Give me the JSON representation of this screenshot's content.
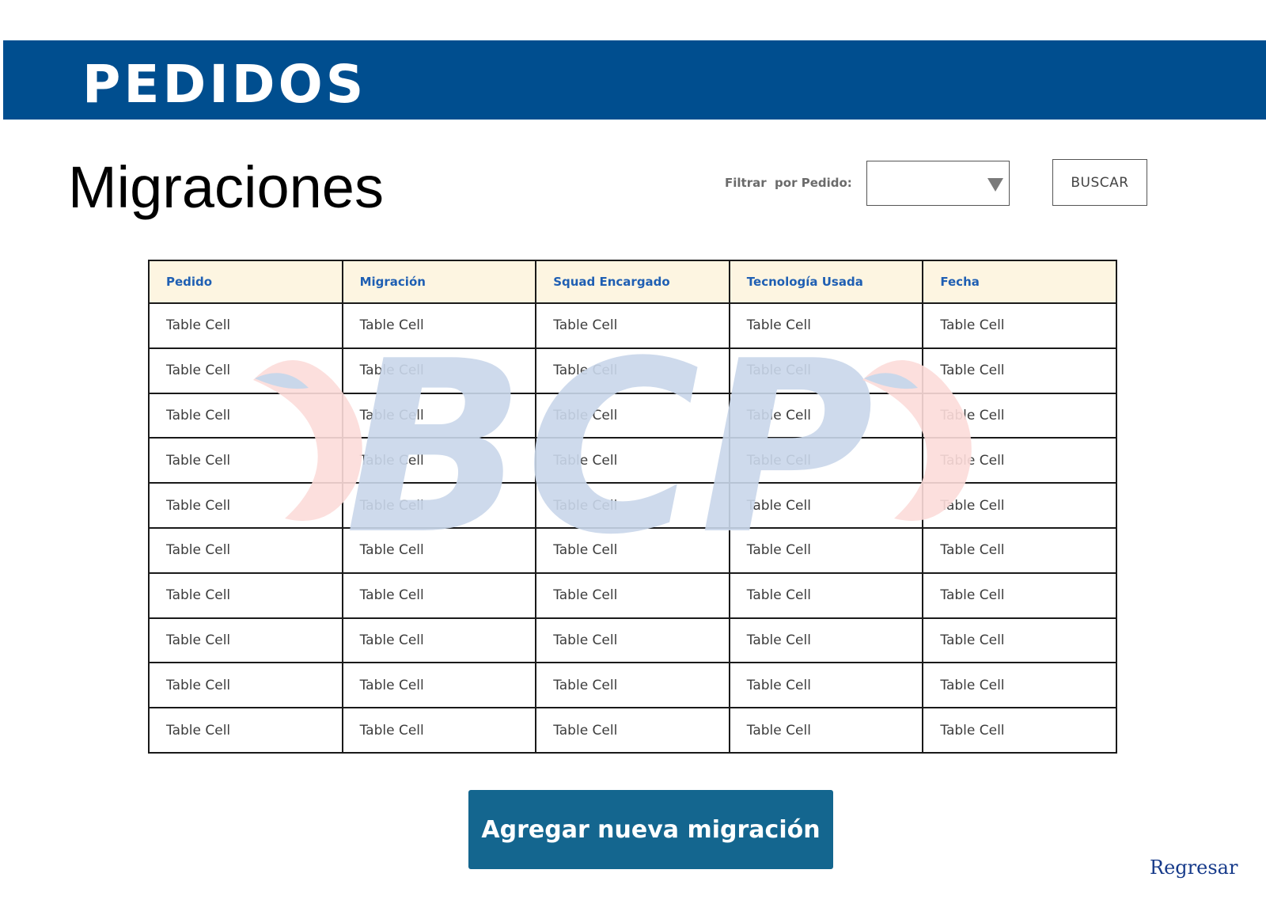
{
  "header": {
    "title": "PEDIDOS"
  },
  "page": {
    "title": "Migraciones"
  },
  "filter": {
    "label": "Filtrar  por Pedido:",
    "selected": "",
    "search_label": "BUSCAR"
  },
  "table": {
    "columns": [
      "Pedido",
      "Migración",
      "Squad Encargado",
      "Tecnología Usada",
      "Fecha"
    ],
    "rows": [
      [
        "Table Cell",
        "Table Cell",
        "Table Cell",
        "Table Cell",
        "Table Cell"
      ],
      [
        "Table Cell",
        "Table Cell",
        "Table Cell",
        "Table Cell",
        "Table Cell"
      ],
      [
        "Table Cell",
        "Table Cell",
        "Table Cell",
        "Table Cell",
        "Table Cell"
      ],
      [
        "Table Cell",
        "Table Cell",
        "Table Cell",
        "Table Cell",
        "Table Cell"
      ],
      [
        "Table Cell",
        "Table Cell",
        "Table Cell",
        "Table Cell",
        "Table Cell"
      ],
      [
        "Table Cell",
        "Table Cell",
        "Table Cell",
        "Table Cell",
        "Table Cell"
      ],
      [
        "Table Cell",
        "Table Cell",
        "Table Cell",
        "Table Cell",
        "Table Cell"
      ],
      [
        "Table Cell",
        "Table Cell",
        "Table Cell",
        "Table Cell",
        "Table Cell"
      ],
      [
        "Table Cell",
        "Table Cell",
        "Table Cell",
        "Table Cell",
        "Table Cell"
      ],
      [
        "Table Cell",
        "Table Cell",
        "Table Cell",
        "Table Cell",
        "Table Cell"
      ]
    ]
  },
  "watermark": {
    "text": "BCP",
    "icon": "bcp-logo-watermark"
  },
  "actions": {
    "add_label": "Agregar nueva migración",
    "back_label": "Regresar"
  },
  "colors": {
    "header_bg": "#004e8f",
    "table_header_bg": "#fdf5e1",
    "table_header_text": "#1f5fb3",
    "primary_button": "#14668f",
    "link": "#163a8a",
    "watermark_blue": "#c9d7ea",
    "watermark_red": "#fcdcd9"
  }
}
